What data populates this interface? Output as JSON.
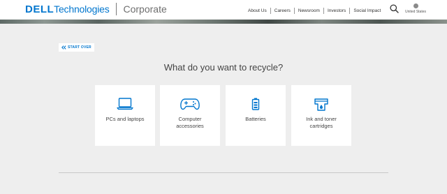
{
  "header": {
    "logo_dell": "DELL",
    "logo_technologies": "Technologies",
    "logo_subtitle": "Corporate",
    "nav": [
      "About Us",
      "Careers",
      "Newsroom",
      "Investors",
      "Social Impact"
    ],
    "search_icon": "search-icon",
    "region_label": "United States"
  },
  "start_over_label": "START OVER",
  "question": "What do you want to recycle?",
  "cards": [
    {
      "label": "PCs and laptops",
      "icon": "laptop-icon"
    },
    {
      "label": "Computer accessories",
      "icon": "gamepad-icon"
    },
    {
      "label": "Batteries",
      "icon": "battery-icon"
    },
    {
      "label": "Ink and toner cartridges",
      "icon": "ink-cartridge-icon"
    }
  ],
  "colors": {
    "accent": "#0076ce",
    "background": "#eeeeee",
    "card": "#ffffff"
  }
}
